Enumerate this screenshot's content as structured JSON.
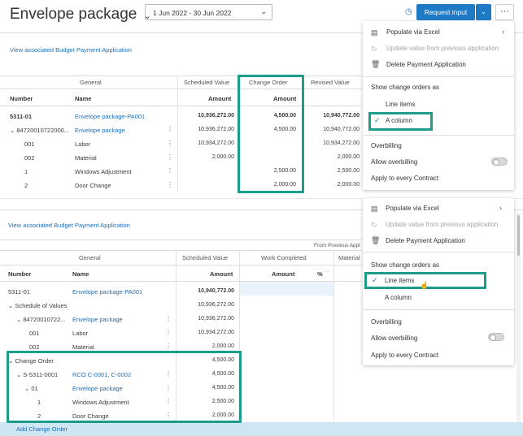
{
  "header": {
    "title": "Envelope package",
    "date_range": "1 Jun 2022 - 30 Jun 2022",
    "request_input": "Request input"
  },
  "top_panel": {
    "link": "View associated Budget Payment Application",
    "groups": {
      "general": "General",
      "scheduled": "Scheduled Value",
      "change_order": "Change Order",
      "revised": "Revised Value"
    },
    "cols": {
      "number": "Number",
      "name": "Name",
      "amount": "Amount"
    },
    "rows": [
      {
        "number": "5311-01",
        "name": "Envelope package-PA001",
        "scheduled": "10,936,272.00",
        "change": "4,500.00",
        "revised": "10,940,772.00"
      },
      {
        "number": "84720010722000...",
        "name": "Envelope package",
        "scheduled": "10,936,272.00",
        "change": "4,500.00",
        "revised": "10,940,772.00"
      },
      {
        "number": "001",
        "name": "Labor",
        "scheduled": "10,934,272.00",
        "change": "",
        "revised": "10,934,272.00"
      },
      {
        "number": "002",
        "name": "Material",
        "scheduled": "2,000.00",
        "change": "",
        "revised": "2,000.00"
      },
      {
        "number": "1",
        "name": "Windows Adjustment",
        "scheduled": "",
        "change": "2,500.00",
        "revised": "2,500.00"
      },
      {
        "number": "2",
        "name": "Door Change",
        "scheduled": "",
        "change": "2,000.00",
        "revised": "2,000.00"
      }
    ]
  },
  "bottom_panel": {
    "link": "View associated Budget Payment Application",
    "groups": {
      "general": "General",
      "scheduled": "Scheduled Value",
      "from_previous": "From Previous Appl",
      "work_completed": "Work Completed",
      "materials": "Material"
    },
    "cols": {
      "number": "Number",
      "name": "Name",
      "amount": "Amount",
      "pct": "%"
    },
    "rows": [
      {
        "number": "5311-01",
        "name": "Envelope package-PA001",
        "amount": "10,940,772.00"
      },
      {
        "number": "Schedule of Values",
        "name": "",
        "amount": "10,936,272.00"
      },
      {
        "number": "84720010722...",
        "name": "Envelope package",
        "amount": "10,936,272.00"
      },
      {
        "number": "001",
        "name": "Labor",
        "amount": "10,934,272.00"
      },
      {
        "number": "002",
        "name": "Material",
        "amount": "2,000.00"
      },
      {
        "number": "Change Order",
        "name": "",
        "amount": "4,500.00"
      },
      {
        "number": "S-5311-0001",
        "name": "RCO C-0001, C-0002",
        "amount": "4,500.00"
      },
      {
        "number": "01",
        "name": "Envelope package",
        "amount": "4,500.00"
      },
      {
        "number": "1",
        "name": "Windows Adjustment",
        "amount": "2,500.00"
      },
      {
        "number": "2",
        "name": "Door Change",
        "amount": "2,000.00"
      }
    ],
    "add_change_order": "Add Change Order"
  },
  "menu_top": {
    "populate": "Populate via Excel",
    "update": "Update value from previous application",
    "delete": "Delete Payment Application",
    "show_co": "Show change orders as",
    "line_items": "Line items",
    "a_column": "A column",
    "overbilling": "Overbilling",
    "allow_overbilling": "Allow overbilling",
    "apply_every": "Apply to every Contract"
  },
  "menu_bottom": {
    "populate": "Populate via Excel",
    "update": "Update value from previous application",
    "delete": "Delete Payment Application",
    "show_co": "Show change orders as",
    "line_items": "Line items",
    "a_column": "A column",
    "overbilling": "Overbilling",
    "allow_overbilling": "Allow overbilling",
    "apply_every": "Apply to every Contract"
  }
}
